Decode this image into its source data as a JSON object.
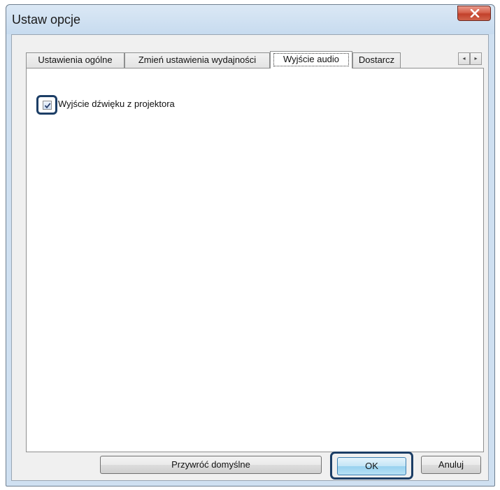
{
  "window": {
    "title": "Ustaw opcje"
  },
  "tabs": [
    {
      "label": "Ustawienia ogólne",
      "active": false
    },
    {
      "label": "Zmień ustawienia wydajności",
      "active": false
    },
    {
      "label": "Wyjście audio",
      "active": true
    },
    {
      "label": "Dostarcz",
      "active": false
    }
  ],
  "tab_scroll": {
    "left": "◂",
    "right": "▸"
  },
  "audio": {
    "checkbox_label": "Wyjście dźwięku z projektora",
    "checked": true
  },
  "buttons": {
    "restore": "Przywróć domyślne",
    "ok": "OK",
    "cancel": "Anuluj"
  },
  "colors": {
    "highlight_frame": "#1c3e66",
    "close_button": "#c9503a",
    "window_frame": "#cfe0f1"
  }
}
